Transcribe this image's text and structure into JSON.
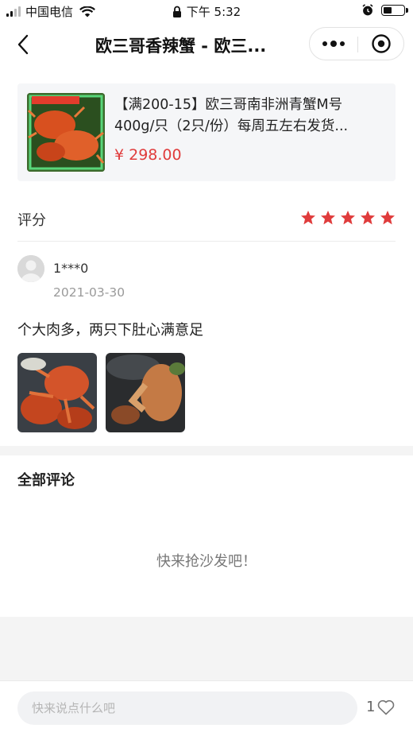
{
  "status_bar": {
    "carrier": "中国电信",
    "time": "下午 5:32",
    "icons": [
      "signal-icon",
      "wifi-icon",
      "lock-icon",
      "alarm-icon",
      "battery-icon"
    ],
    "battery_level": 0.4
  },
  "nav": {
    "title": "欧三哥香辣蟹 - 欧三...",
    "back_icon": "chevron-left-icon",
    "more_icon": "more-dots-icon",
    "close_icon": "target-close-icon"
  },
  "product": {
    "name": "【满200-15】欧三哥南非洲青蟹M号400g/只（2只/份）每周五左右发货...",
    "price": "¥ 298.00",
    "price_color": "#e03c3c"
  },
  "rating": {
    "label": "评分",
    "stars": 5,
    "star_color": "#e03c3c"
  },
  "review": {
    "user": "1***0",
    "date": "2021-03-30",
    "text": "个大肉多，两只下肚心满意足",
    "photo_count": 2
  },
  "comments": {
    "title": "全部评论",
    "empty_text": "快来抢沙发吧！"
  },
  "bottom_bar": {
    "input_placeholder": "快来说点什么吧",
    "like_count": "1",
    "like_icon": "heart-icon"
  }
}
